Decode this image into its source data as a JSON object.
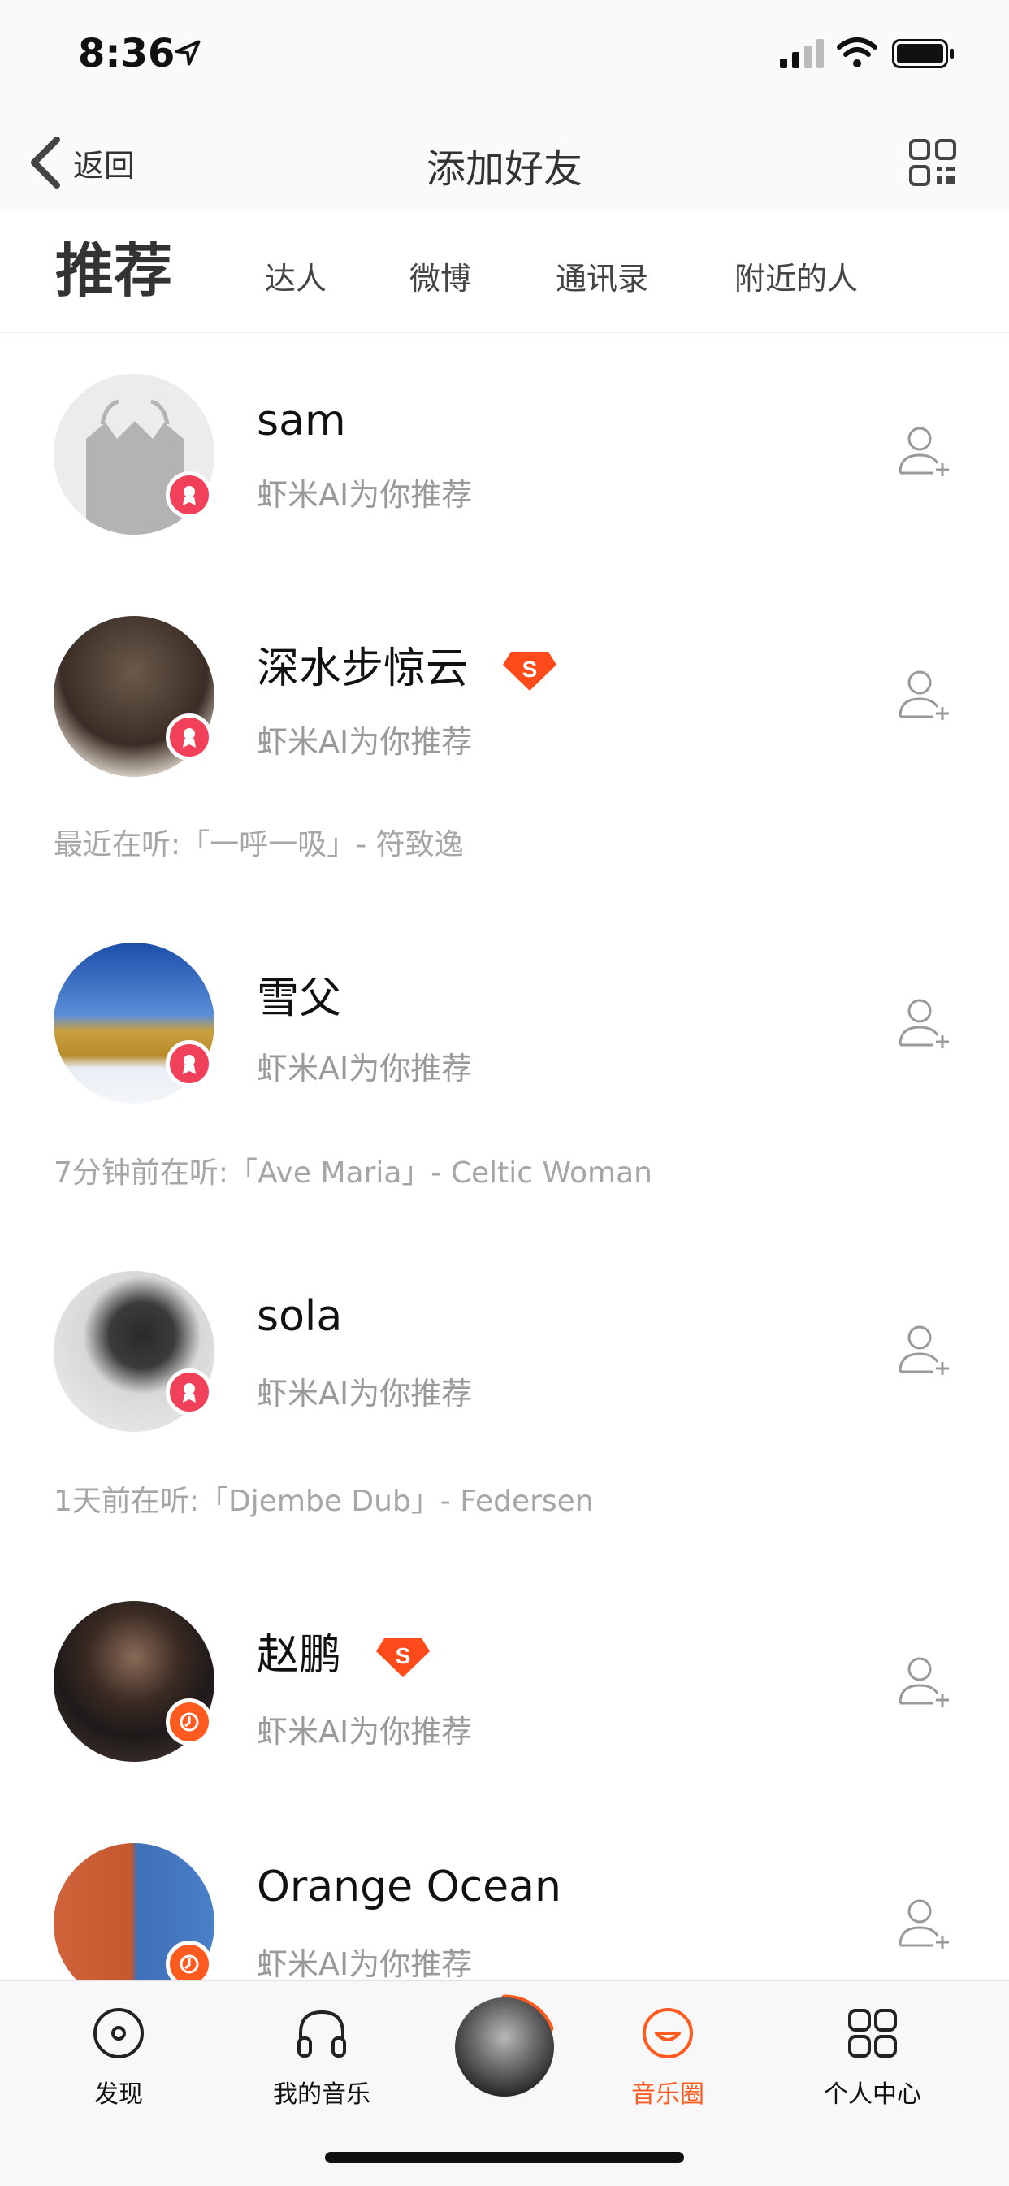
{
  "status": {
    "time": "8:36"
  },
  "nav": {
    "back_label": "返回",
    "title": "添加好友"
  },
  "tabs": {
    "active": "推荐",
    "items": [
      "达人",
      "微博",
      "通讯录",
      "附近的人"
    ]
  },
  "users": [
    {
      "name": "sam",
      "sub": "虾米AI为你推荐",
      "listening": "",
      "vip": false,
      "badge": "red"
    },
    {
      "name": "深水步惊云",
      "sub": "虾米AI为你推荐",
      "listening": "最近在听:「一呼一吸」- 符致逸",
      "vip": true,
      "badge": "red"
    },
    {
      "name": "雪父",
      "sub": "虾米AI为你推荐",
      "listening": "7分钟前在听:「Ave Maria」- Celtic Woman",
      "vip": false,
      "badge": "red"
    },
    {
      "name": "sola",
      "sub": "虾米AI为你推荐",
      "listening": "1天前在听:「Djembe Dub」- Federsen",
      "vip": false,
      "badge": "red"
    },
    {
      "name": "赵鹏",
      "sub": "虾米AI为你推荐",
      "listening": "",
      "vip": true,
      "badge": "orange"
    },
    {
      "name": "Orange Ocean",
      "sub": "虾米AI为你推荐",
      "listening": "",
      "vip": false,
      "badge": "orange"
    }
  ],
  "tabbar": {
    "items": [
      "发现",
      "我的音乐",
      "音乐圈",
      "个人中心"
    ],
    "active": "音乐圈"
  },
  "colors": {
    "accent": "#ff5a20",
    "badge_red": "#f0405a",
    "muted": "#999999"
  },
  "icons": [
    "back-chevron-icon",
    "qr-code-icon",
    "add-friend-icon",
    "vip-s-icon",
    "disc-icon",
    "headphones-icon",
    "music-circle-icon",
    "grid-icon"
  ]
}
